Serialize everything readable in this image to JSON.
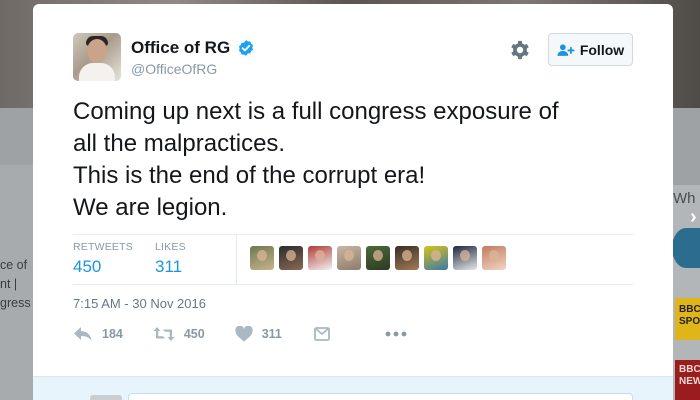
{
  "background": {
    "left_text": [
      "ce of",
      "nt |",
      "gress"
    ],
    "right_label": "Wh",
    "right_badge_1": "BBC SPO",
    "right_badge_2": "BBC NEW"
  },
  "tweet": {
    "author_name": "Office of RG",
    "author_handle": "@OfficeOfRG",
    "verified": true,
    "follow_label": "Follow",
    "text_lines": [
      "Coming up next is a full congress exposure of",
      "all the malpractices.",
      "This is the end of the corrupt era!",
      "We are legion."
    ],
    "stats": {
      "retweets_label": "RETWEETS",
      "retweets_value": "450",
      "likes_label": "LIKES",
      "likes_value": "311"
    },
    "likers": [
      {
        "colors": [
          "#6b7a4e",
          "#c9b38d"
        ]
      },
      {
        "colors": [
          "#2b2b2b",
          "#8a6a55"
        ]
      },
      {
        "colors": [
          "#b23a3a",
          "#f2f2f2"
        ]
      },
      {
        "colors": [
          "#c7b7a3",
          "#8d7b6b"
        ]
      },
      {
        "colors": [
          "#4d6b3a",
          "#2c3a22"
        ]
      },
      {
        "colors": [
          "#3a2e25",
          "#a17b55"
        ]
      },
      {
        "colors": [
          "#d8c21a",
          "#3a7aa8"
        ]
      },
      {
        "colors": [
          "#1c2640",
          "#e8e8e8"
        ]
      },
      {
        "colors": [
          "#c27b5e",
          "#f0d6c4"
        ]
      }
    ],
    "timestamp": "7:15 AM - 30 Nov 2016",
    "actions": {
      "reply_count": "184",
      "retweet_count": "450",
      "like_count": "311"
    }
  },
  "colors": {
    "accent": "#1b95e0",
    "verified": "#1da1f2",
    "muted": "#8899a6"
  }
}
